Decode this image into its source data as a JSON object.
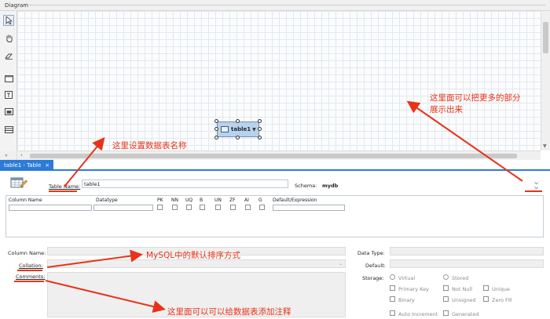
{
  "diagram": {
    "title": "Diagram",
    "zoom_indicator": "«",
    "tools": [
      "pointer-icon",
      "hand-icon",
      "eraser-icon",
      "layer-icon",
      "text-note-icon",
      "image-icon",
      "new-table-icon"
    ],
    "table_node": {
      "name": "table1",
      "chevron": "▼"
    }
  },
  "tab": {
    "label": "table1 - Table",
    "close": "×"
  },
  "editor": {
    "table_name_label": "Table Name:",
    "table_name_value": "table1",
    "schema_label": "Schema:",
    "schema_value": "mydb",
    "collapse_glyph": "˅",
    "columns_header": [
      "Column Name",
      "Datatype",
      "PK",
      "NN",
      "UQ",
      "B",
      "UN",
      "ZF",
      "AI",
      "G",
      "Default/Expression"
    ],
    "column_name_label": "Column Name:",
    "collation_label": "Collation:",
    "comments_label": "Comments:",
    "data_type_label": "Data Type:",
    "default_label": "Default:",
    "storage_label": "Storage:",
    "storage_options": {
      "virtual": "Virtual",
      "stored": "Stored"
    },
    "flags": {
      "primary_key": "Primary Key",
      "not_null": "Not Null",
      "unique": "Unique",
      "binary": "Binary",
      "unsigned": "Unsigned",
      "zero_fill": "Zero Fill",
      "auto_increment": "Auto Increment",
      "generated": "Generated"
    }
  },
  "annotations": {
    "expand": "这里面可以把更多的部分\n展示出来",
    "table_name": "这里设置数据表名称",
    "collation": "MySQL中的默认排序方式",
    "comments": "这里面可以可以给数据表添加注释"
  },
  "colors": {
    "accent": "#2c7bd8",
    "annotation": "#e8331a",
    "table_node": "#b9d2ea"
  }
}
